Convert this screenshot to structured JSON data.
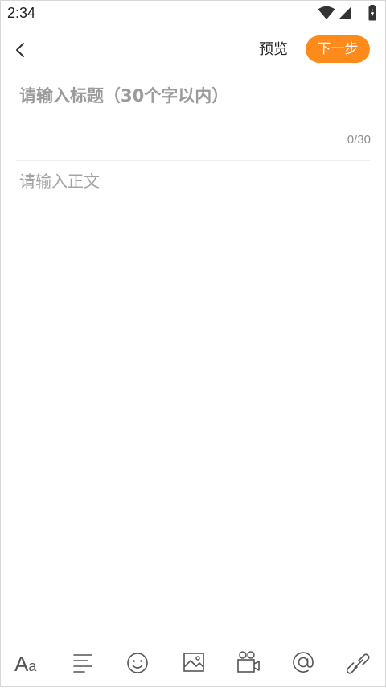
{
  "status_bar": {
    "time": "2:34",
    "icons": [
      "wifi-icon",
      "cell-signal-icon",
      "battery-charging-icon"
    ]
  },
  "header": {
    "back_icon": "chevron-left-icon",
    "preview_label": "预览",
    "next_label": "下一步",
    "next_color": "#ff8a1c"
  },
  "editor": {
    "title_placeholder": "请输入标题（30个字以内）",
    "title_value": "",
    "title_counter": "0/30",
    "body_placeholder": "请输入正文",
    "body_value": ""
  },
  "toolbar": {
    "font_label_big": "A",
    "font_label_small": "a",
    "items": [
      "text-format-icon",
      "align-icon",
      "emoji-icon",
      "image-icon",
      "video-icon",
      "mention-icon",
      "link-icon"
    ]
  }
}
